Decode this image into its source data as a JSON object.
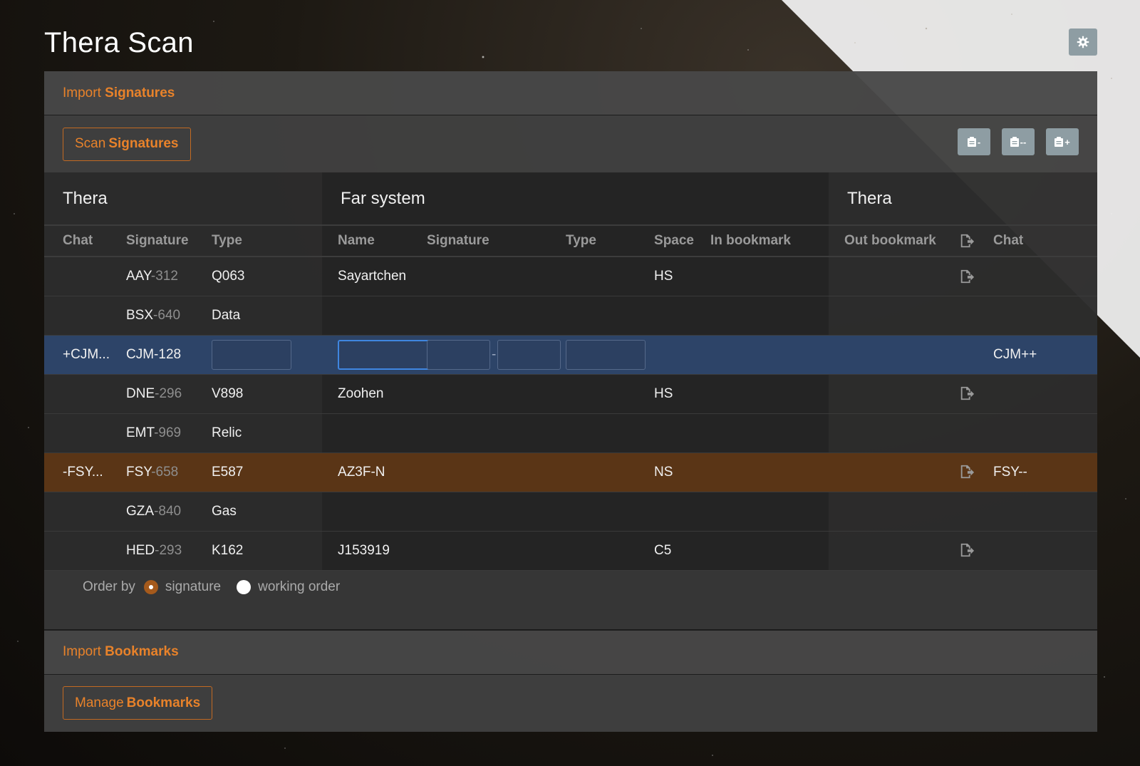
{
  "app": {
    "title": "Thera Scan"
  },
  "import_signatures": {
    "prefix": "Import",
    "label": "Signatures"
  },
  "scan_button": {
    "prefix": "Scan",
    "label": "Signatures"
  },
  "clipboard_buttons": [
    {
      "icon": "clipboard-icon",
      "suffix": "-"
    },
    {
      "icon": "clipboard-icon",
      "suffix": "--"
    },
    {
      "icon": "clipboard-icon",
      "suffix": "+"
    }
  ],
  "table": {
    "groups": {
      "left": "Thera",
      "far": "Far system",
      "right": "Thera"
    },
    "headers": {
      "chat": "Chat",
      "signature": "Signature",
      "type": "Type",
      "name": "Name",
      "far_signature": "Signature",
      "far_type": "Type",
      "space": "Space",
      "in_bookmark": "In bookmark",
      "out_bookmark": "Out bookmark",
      "chat_right": "Chat"
    },
    "rows": [
      {
        "chat": "",
        "sig_prefix": "AAY",
        "sig_suffix": "-312",
        "type": "Q063",
        "type_dim": false,
        "name": "Sayartchen",
        "space": "HS",
        "export": true,
        "chat_right": ""
      },
      {
        "chat": "",
        "sig_prefix": "BSX",
        "sig_suffix": "-640",
        "type": "Data",
        "type_dim": true,
        "name": "",
        "space": "",
        "export": false,
        "chat_right": ""
      },
      {
        "chat": "+CJM...",
        "sig_prefix": "CJM-128",
        "sig_suffix": "",
        "type": "",
        "type_dim": false,
        "name": "",
        "space": "",
        "export": false,
        "chat_right": "CJM++"
      },
      {
        "chat": "",
        "sig_prefix": "DNE",
        "sig_suffix": "-296",
        "type": "V898",
        "type_dim": false,
        "name": "Zoohen",
        "space": "HS",
        "export": true,
        "chat_right": ""
      },
      {
        "chat": "",
        "sig_prefix": "EMT",
        "sig_suffix": "-969",
        "type": "Relic",
        "type_dim": true,
        "name": "",
        "space": "",
        "export": false,
        "chat_right": ""
      },
      {
        "chat": "-FSY...",
        "sig_prefix": "FSY",
        "sig_suffix": "-658",
        "type": "E587",
        "type_dim": false,
        "name": "AZ3F-N",
        "space": "NS",
        "export": true,
        "chat_right": "FSY--"
      },
      {
        "chat": "",
        "sig_prefix": "GZA",
        "sig_suffix": "-840",
        "type": "Gas",
        "type_dim": true,
        "name": "",
        "space": "",
        "export": false,
        "chat_right": ""
      },
      {
        "chat": "",
        "sig_prefix": "HED",
        "sig_suffix": "-293",
        "type": "K162",
        "type_dim": false,
        "name": "J153919",
        "space": "C5",
        "export": true,
        "chat_right": ""
      }
    ]
  },
  "order_by": {
    "label": "Order by",
    "options": [
      "signature",
      "working order"
    ],
    "selected": "signature"
  },
  "import_bookmarks": {
    "prefix": "Import",
    "label": "Bookmarks"
  },
  "manage_button": {
    "prefix": "Manage",
    "label": "Bookmarks"
  },
  "colors": {
    "accent": "#e8822a",
    "selected_row": "#2d4468",
    "warning_row": "#5a3516",
    "button_gray": "#8e9da3"
  }
}
